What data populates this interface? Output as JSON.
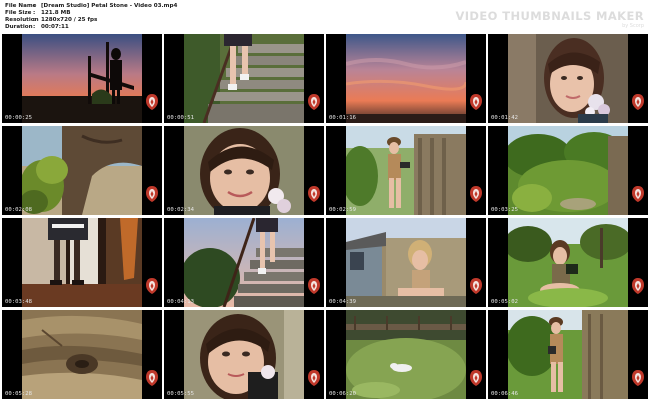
{
  "meta": {
    "rows": [
      {
        "key": "File Name",
        "sep": ":",
        "value": "[Dream Studio] Petal Stone - Video 03.mp4"
      },
      {
        "key": "File Size",
        "sep": ":",
        "value": "121.8 MB"
      },
      {
        "key": "Resolution",
        "sep": ":",
        "value": "1280x720 / 25 fps"
      },
      {
        "key": "Duration",
        "sep": ":",
        "value": "00:07:11"
      }
    ]
  },
  "brand": {
    "title": "VIDEO THUMBNAILS MAKER",
    "subtitle": "by Scorp"
  },
  "colors": {
    "watermark_red": "#c0392b",
    "timestamp": "#e6e6e6",
    "tile_bg": "#000000"
  },
  "thumbnails": [
    {
      "timestamp": "00:00:25",
      "scene": "sunset-silhouette"
    },
    {
      "timestamp": "00:00:51",
      "scene": "stairs-legs"
    },
    {
      "timestamp": "00:01:16",
      "scene": "sunset-sky"
    },
    {
      "timestamp": "00:01:42",
      "scene": "closeup-flower"
    },
    {
      "timestamp": "00:02:08",
      "scene": "tree-branch"
    },
    {
      "timestamp": "00:02:34",
      "scene": "closeup-smile"
    },
    {
      "timestamp": "00:02:59",
      "scene": "girl-wall"
    },
    {
      "timestamp": "00:03:25",
      "scene": "garden-green"
    },
    {
      "timestamp": "00:03:48",
      "scene": "interior-door"
    },
    {
      "timestamp": "00:04:13",
      "scene": "stairs-evening"
    },
    {
      "timestamp": "00:04:39",
      "scene": "shed-sitting"
    },
    {
      "timestamp": "00:05:02",
      "scene": "girl-sitting-grass"
    },
    {
      "timestamp": "00:05:28",
      "scene": "wood-closeup"
    },
    {
      "timestamp": "00:05:55",
      "scene": "closeup-lookup"
    },
    {
      "timestamp": "00:06:20",
      "scene": "grass-field"
    },
    {
      "timestamp": "00:06:46",
      "scene": "girl-standing-grass"
    }
  ]
}
